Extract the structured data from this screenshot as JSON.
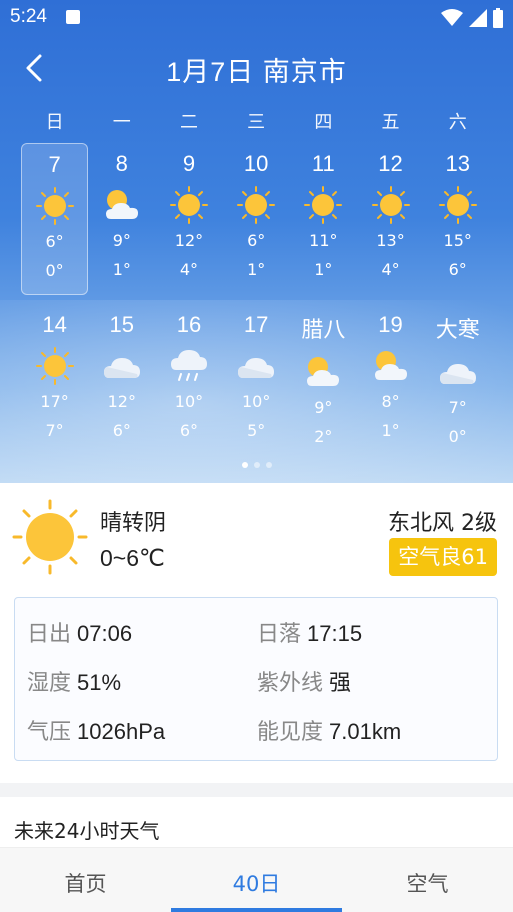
{
  "status": {
    "time": "5:24"
  },
  "header": {
    "title": "1月7日 南京市"
  },
  "weekdays": [
    "日",
    "一",
    "二",
    "三",
    "四",
    "五",
    "六"
  ],
  "week1": [
    {
      "label": "7",
      "icon": "sunny",
      "hi": "6°",
      "lo": "0°",
      "selected": true
    },
    {
      "label": "8",
      "icon": "partly-cloudy",
      "hi": "9°",
      "lo": "1°"
    },
    {
      "label": "9",
      "icon": "sunny",
      "hi": "12°",
      "lo": "4°"
    },
    {
      "label": "10",
      "icon": "sunny",
      "hi": "6°",
      "lo": "1°"
    },
    {
      "label": "11",
      "icon": "sunny",
      "hi": "11°",
      "lo": "1°"
    },
    {
      "label": "12",
      "icon": "sunny",
      "hi": "13°",
      "lo": "4°"
    },
    {
      "label": "13",
      "icon": "sunny",
      "hi": "15°",
      "lo": "6°"
    }
  ],
  "week2": [
    {
      "label": "14",
      "icon": "sunny",
      "hi": "17°",
      "lo": "7°"
    },
    {
      "label": "15",
      "icon": "cloudy",
      "hi": "12°",
      "lo": "6°"
    },
    {
      "label": "16",
      "icon": "rain",
      "hi": "10°",
      "lo": "6°"
    },
    {
      "label": "17",
      "icon": "cloudy",
      "hi": "10°",
      "lo": "5°"
    },
    {
      "label": "腊八",
      "icon": "partly-cloudy",
      "hi": "9°",
      "lo": "2°"
    },
    {
      "label": "19",
      "icon": "partly-cloudy",
      "hi": "8°",
      "lo": "1°"
    },
    {
      "label": "大寒",
      "icon": "cloudy",
      "hi": "7°",
      "lo": "0°"
    }
  ],
  "pager": {
    "count": 3,
    "active": 0
  },
  "today": {
    "icon": "sunny",
    "condition": "晴转阴",
    "temp_range": "0~6℃",
    "wind": "东北风 2级",
    "aqi": "空气良61"
  },
  "details": {
    "sunrise_label": "日出",
    "sunrise": "07:06",
    "sunset_label": "日落",
    "sunset": "17:15",
    "humidity_label": "湿度",
    "humidity": "51%",
    "uv_label": "紫外线",
    "uv": "强",
    "pressure_label": "气压",
    "pressure": "1026hPa",
    "visibility_label": "能见度",
    "visibility": "7.01km"
  },
  "forecast24": {
    "title": "未来24小时天气"
  },
  "tabs": [
    {
      "label": "首页",
      "active": false
    },
    {
      "label": "40日",
      "active": true
    },
    {
      "label": "空气",
      "active": false
    }
  ],
  "colors": {
    "accent": "#2f7be0",
    "sun": "#f8b92b",
    "aqi_bg": "#f6c40e"
  }
}
